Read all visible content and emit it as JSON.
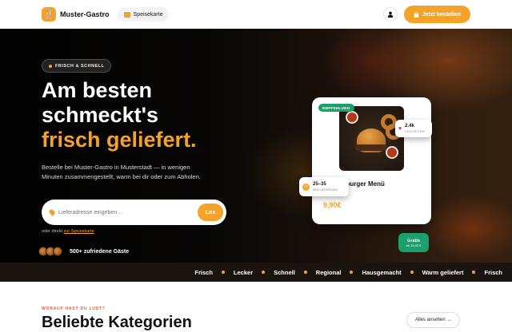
{
  "header": {
    "brand": "Muster-Gastro",
    "menu_label": "Speisekarte",
    "order_label": "Jetzt bestellen",
    "colors": {
      "accent": "#f4a32a",
      "green": "#1aa06a"
    }
  },
  "hero": {
    "badge": "FRISCH & SCHNELL",
    "headline_line1": "Am besten",
    "headline_line2": "schmeckt's",
    "headline_highlight": "frisch geliefert.",
    "description": "Bestelle bei Muster-Gastro in Musterstadt — in wenigen Minuten zusammengestellt, warm bei dir oder zum Abholen.",
    "search": {
      "placeholder": "Lieferadresse eingeben ...",
      "button": "Los"
    },
    "direct_prefix": "oder direkt",
    "direct_link": "zur Speisekarte",
    "guests": "500+ zufriedene Gäste"
  },
  "card": {
    "badge": "EMPFEHLUNG",
    "title": "Cheeseburger Menü",
    "stars": "★★★★★",
    "price": "9,90€",
    "favorites_count": "2.4k",
    "favorites_label": "FAVORITEN",
    "delivery_time": "25–35",
    "delivery_label": "MIN LIEFERUNG",
    "free_title": "Gratis",
    "free_sub": "ab 15,00 €"
  },
  "ticker": [
    "Frisch",
    "Lecker",
    "Schnell",
    "Regional",
    "Hausgemacht",
    "Warm geliefert",
    "Frisch"
  ],
  "section": {
    "kicker": "WORAUF HAST DU LUST?",
    "title": "Beliebte Kategorien",
    "all_button": "Alles ansehen →"
  },
  "icons": [
    "fork-knife-icon",
    "menu-icon",
    "user-icon",
    "bag-icon",
    "location-pin-icon",
    "heart-icon",
    "clock-icon"
  ]
}
